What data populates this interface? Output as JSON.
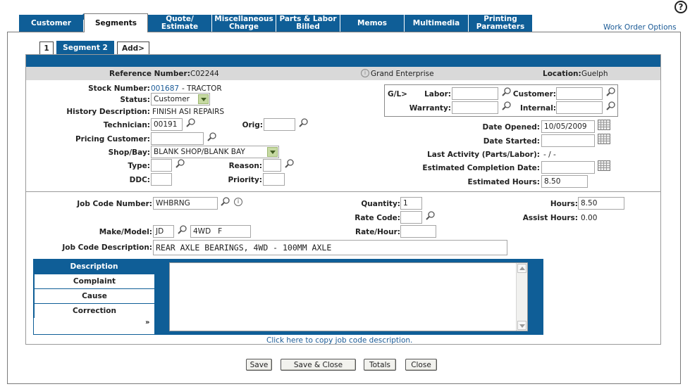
{
  "top_tabs": [
    "Customer",
    "Segments",
    "Quote/\nEstimate",
    "Miscellaneous\nCharge",
    "Parts & Labor\nBilled",
    "Memos",
    "Multimedia",
    "Printing\nParameters"
  ],
  "work_order_options": "Work Order Options",
  "help_label": "?",
  "segment_tabs": [
    "1",
    "Segment 2",
    "Add>"
  ],
  "info_bar": {
    "reference_label": "Reference Number:",
    "reference_value": "C02244",
    "customer_name": "Grand Enterprise",
    "location_label": "Location:",
    "location_value": "Guelph"
  },
  "segment": {
    "stock_number_label": "Stock Number:",
    "stock_number_link": "001687",
    "stock_number_desc": "- TRACTOR",
    "status_label": "Status:",
    "status_value": "Customer",
    "history_label": "History Description:",
    "history_value": "FINISH ASI REPAIRS",
    "technician_label": "Technician:",
    "technician_value": "00191",
    "orig_label": "Orig:",
    "orig_value": "",
    "pricing_customer_label": "Pricing Customer:",
    "pricing_customer_value": "",
    "shop_bay_label": "Shop/Bay:",
    "shop_bay_value": "BLANK SHOP/BLANK BAY",
    "type_label": "Type:",
    "type_value": "",
    "reason_label": "Reason:",
    "reason_value": "",
    "ddc_label": "DDC:",
    "ddc_value": "",
    "priority_label": "Priority:",
    "priority_value": ""
  },
  "gl": {
    "title": "G/L>",
    "labor_label": "Labor:",
    "labor_value": "",
    "customer_label": "Customer:",
    "customer_value": "",
    "warranty_label": "Warranty:",
    "warranty_value": "",
    "internal_label": "Internal:",
    "internal_value": ""
  },
  "dates": {
    "opened_label": "Date Opened:",
    "opened_value": "10/05/2009",
    "started_label": "Date Started:",
    "started_value": "",
    "last_activity_label": "Last Activity (Parts/Labor):",
    "last_activity_value": "- / -",
    "est_completion_label": "Estimated Completion Date:",
    "est_completion_value": "",
    "est_hours_label": "Estimated Hours:",
    "est_hours_value": "8.50"
  },
  "job": {
    "job_code_label": "Job Code Number:",
    "job_code_value": "WHBRNG",
    "quantity_label": "Quantity:",
    "quantity_value": "1",
    "rate_code_label": "Rate Code:",
    "rate_code_value": "",
    "hours_label": "Hours:",
    "hours_value": "8.50",
    "assist_hours_label": "Assist Hours:",
    "assist_hours_value": "0.00",
    "make_model_label": "Make/Model:",
    "make_value": "JD",
    "model_value": "4WD   F",
    "rate_hour_label": "Rate/Hour:",
    "rate_hour_value": "",
    "job_desc_label": "Job Code Description:",
    "job_desc_value": "REAR AXLE BEARINGS, 4WD - 100MM AXLE"
  },
  "desc_tabs": [
    "Description",
    "Complaint",
    "Cause",
    "Correction"
  ],
  "desc_more": "»",
  "description_text": "",
  "copy_link": "Click here to copy job code description.",
  "buttons": {
    "save": "Save",
    "save_close": "Save & Close",
    "totals": "Totals",
    "close": "Close"
  },
  "colors": {
    "primary_blue": "#0f5e97",
    "info_bar_gray": "#d9d9d9",
    "link_blue": "#1a5a96",
    "select_green": "#c6d9a2"
  }
}
